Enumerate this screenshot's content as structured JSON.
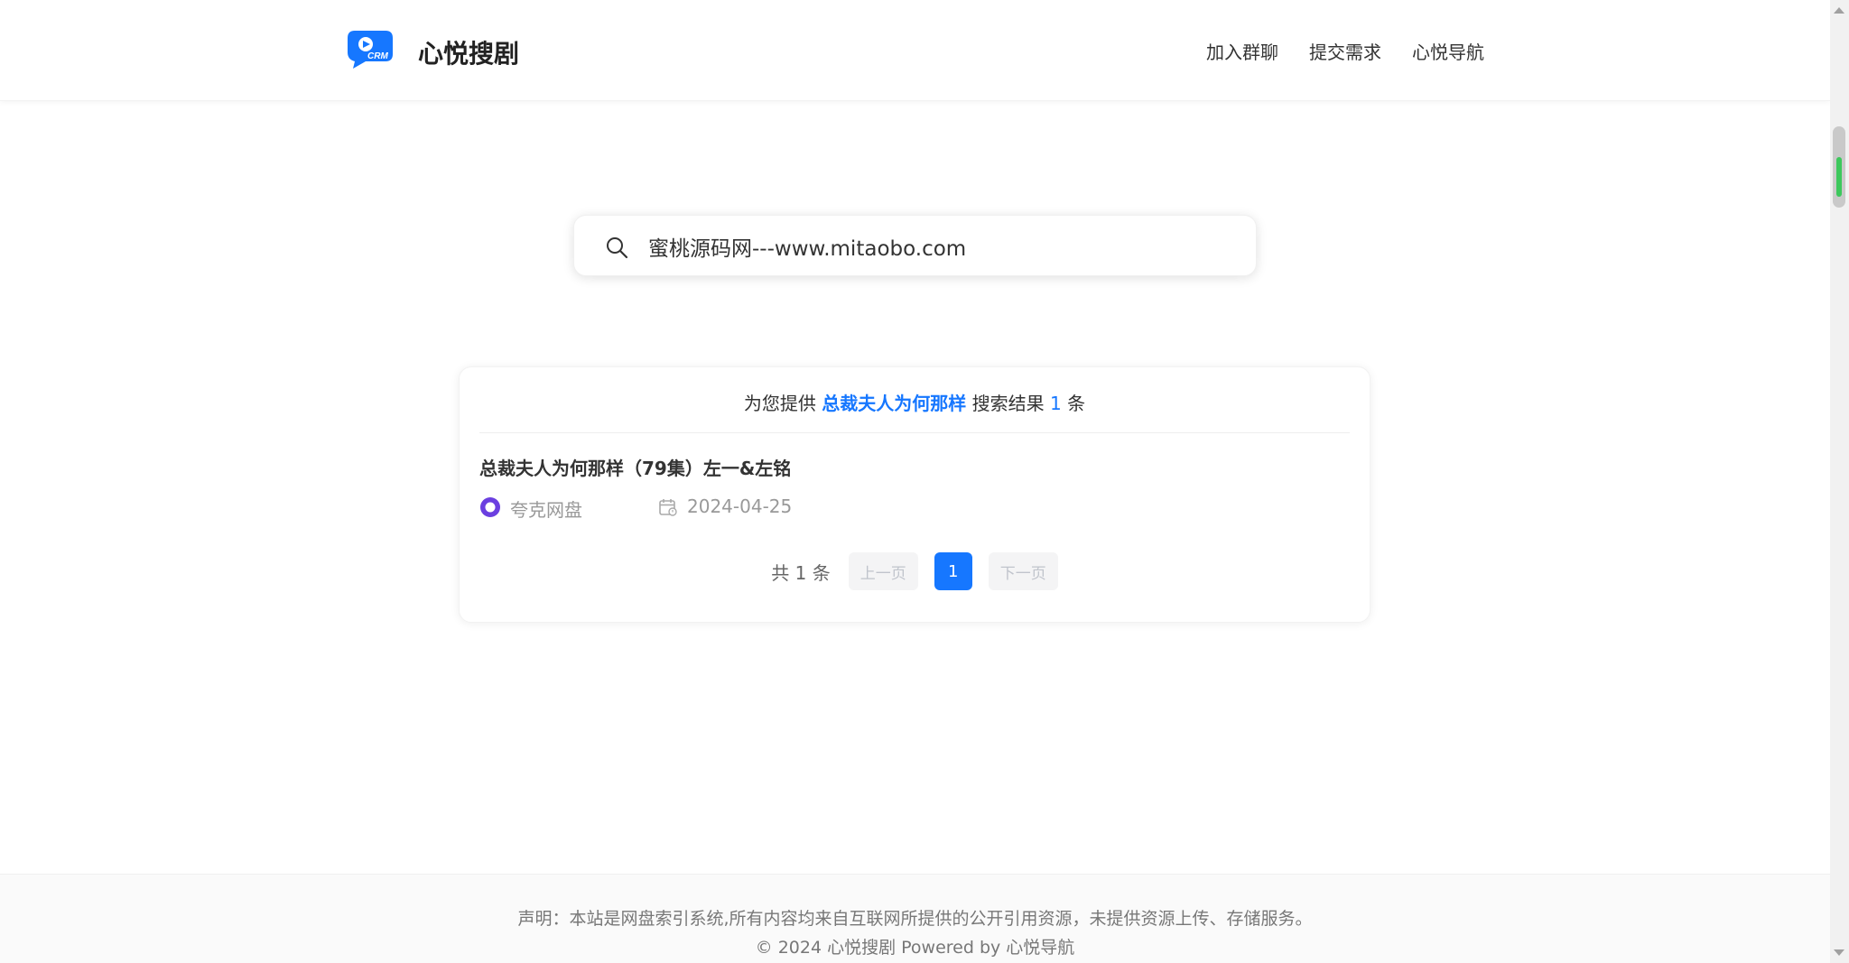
{
  "header": {
    "brand": "心悦搜剧",
    "logo_text": "CRM",
    "nav": [
      {
        "label": "加入群聊"
      },
      {
        "label": "提交需求"
      },
      {
        "label": "心悦导航"
      }
    ]
  },
  "search": {
    "icon": "search-icon",
    "value": "蜜桃源码网---www.mitaobo.com"
  },
  "results": {
    "prefix": "为您提供",
    "keyword": "总裁夫人为何那样",
    "middle": "搜索结果",
    "count": "1",
    "suffix": "条",
    "items": [
      {
        "title": "总裁夫人为何那样（79集）左一&左铭",
        "disk": "夸克网盘",
        "disk_icon": "quark-disk-icon",
        "date_icon": "calendar-icon",
        "date": "2024-04-25"
      }
    ],
    "pagination": {
      "total": "共 1 条",
      "prev": "上一页",
      "current": "1",
      "next": "下一页"
    }
  },
  "footer": {
    "disclaimer": "声明：本站是网盘索引系统,所有内容均来自互联网所提供的公开引用资源，未提供资源上传、存储服务。",
    "copyright": "© 2024 心悦搜剧 Powered by 心悦导航"
  },
  "colors": {
    "accent": "#1677ff",
    "logo": "#1677ff",
    "quark": "#6b3fe0",
    "scroll_fill": "#3cc85c"
  }
}
